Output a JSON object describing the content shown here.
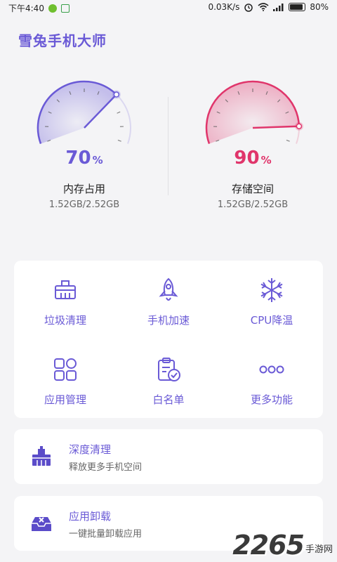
{
  "status_bar": {
    "time": "下午4:40",
    "network_speed": "0.03K/s",
    "battery": "80%"
  },
  "app": {
    "title": "雪兔手机大师"
  },
  "gauges": [
    {
      "id": "memory",
      "value": 70,
      "percent_text": "70",
      "unit": "%",
      "label": "内存占用",
      "detail": "1.52GB/2.52GB",
      "color": "#6a5ad6"
    },
    {
      "id": "storage",
      "value": 90,
      "percent_text": "90",
      "unit": "%",
      "label": "存储空间",
      "detail": "1.52GB/2.52GB",
      "color": "#e0356b"
    }
  ],
  "tools": [
    {
      "label": "垃圾清理",
      "icon": "broom-icon"
    },
    {
      "label": "手机加速",
      "icon": "rocket-icon"
    },
    {
      "label": "CPU降温",
      "icon": "snowflake-icon"
    },
    {
      "label": "应用管理",
      "icon": "apps-grid-icon"
    },
    {
      "label": "白名单",
      "icon": "clipboard-check-icon"
    },
    {
      "label": "更多功能",
      "icon": "more-dots-icon"
    }
  ],
  "list": [
    {
      "title": "深度清理",
      "subtitle": "释放更多手机空间",
      "icon": "deep-clean-icon"
    },
    {
      "title": "应用卸载",
      "subtitle": "一键批量卸载应用",
      "icon": "uninstall-icon"
    }
  ],
  "watermark": {
    "number": "2265",
    "suffix": "手游网"
  },
  "colors": {
    "accent": "#6a5ad6",
    "storage": "#e0356b",
    "background": "#f4f4f6"
  }
}
